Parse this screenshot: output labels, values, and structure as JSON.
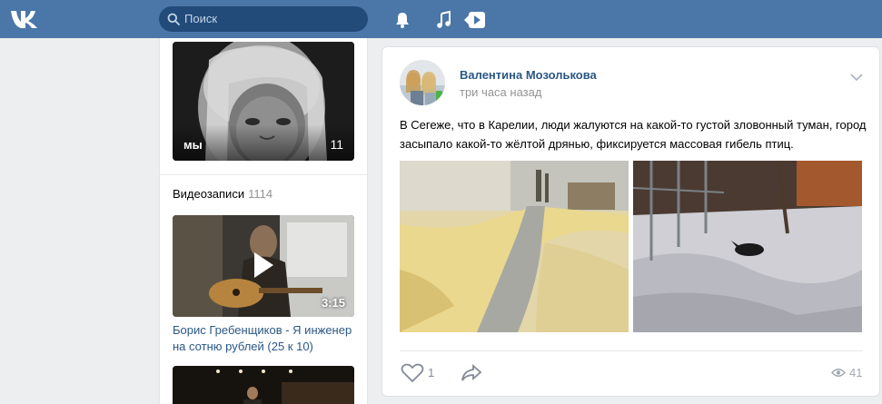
{
  "header": {
    "logo_icon": "vk-logo-icon",
    "search_placeholder": "Поиск",
    "icons": [
      "bell-icon",
      "music-icon",
      "video-play-icon"
    ],
    "bg_color": "#4a76a8"
  },
  "sidebar": {
    "album_title": "мы",
    "album_count": "11",
    "videos_heading": "Видеозаписи",
    "videos_count": "1114",
    "video": {
      "duration": "3:15",
      "title": "Борис Гребенщиков - Я инженер на сотню рублей (25 к 10)"
    }
  },
  "post": {
    "author": "Валентина Мозолькова",
    "time": "три часа назад",
    "text": "В Сегеже, что в Карелии, люди жалуются на какой-то густой зловонный туман, город засыпало какой-то жёлтой дрянью, фиксируется массовая гибель птиц.",
    "likes": "1",
    "views": "41",
    "link_color": "#2a5885"
  }
}
